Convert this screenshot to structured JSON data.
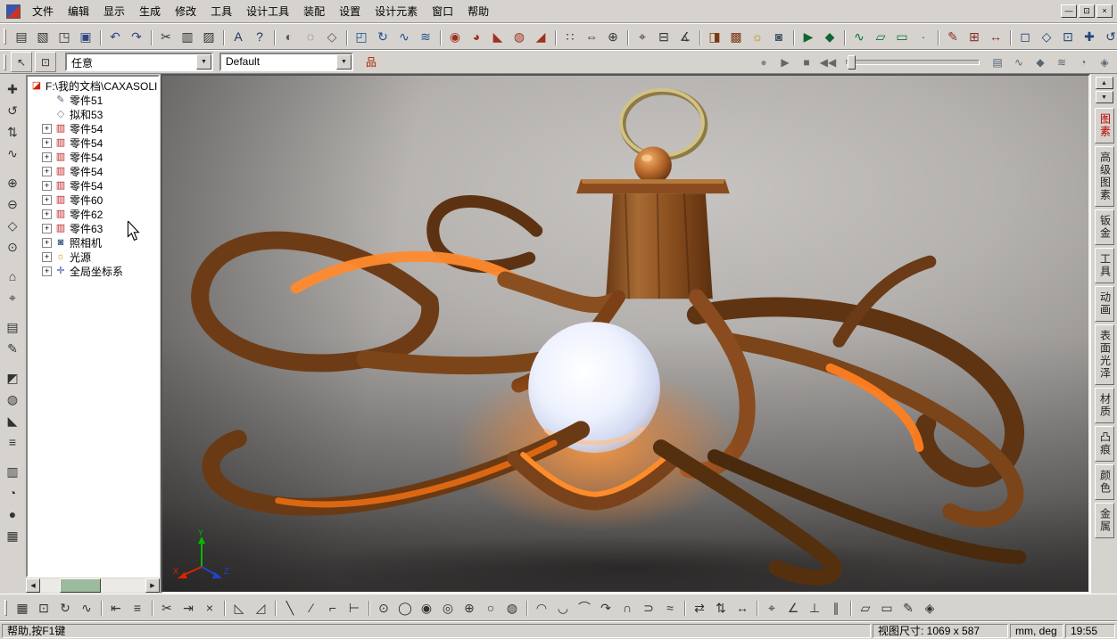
{
  "theme": {
    "chrome": "#d6d3ce",
    "chrome_dark": "#848484",
    "chrome_light": "#ffffff",
    "tree_thumb_green": "#9cba9c"
  },
  "icons": {
    "chevron_down": "▼",
    "scroll_left": "◀",
    "scroll_right": "▶"
  },
  "menu": {
    "items": [
      "文件",
      "编辑",
      "显示",
      "生成",
      "修改",
      "工具",
      "设计工具",
      "装配",
      "设置",
      "设计元素",
      "窗口",
      "帮助"
    ]
  },
  "window_controls": [
    {
      "name": "minimize-button",
      "g": "—"
    },
    {
      "name": "restore-button",
      "g": "⊡"
    },
    {
      "name": "close-button",
      "g": "×"
    }
  ],
  "toolbar_main": {
    "icons": [
      {
        "name": "new-file-icon",
        "g": "▤"
      },
      {
        "name": "new-assembly-icon",
        "g": "▧"
      },
      {
        "name": "open-file-icon",
        "g": "◳"
      },
      {
        "name": "save-icon",
        "g": "▣",
        "c": "#334488"
      },
      {
        "name": "undo-icon",
        "g": "↶",
        "sep": true,
        "c": "#334488"
      },
      {
        "name": "redo-icon",
        "g": "↷",
        "c": "#334488"
      },
      {
        "name": "cut-icon",
        "g": "✂",
        "sep": true
      },
      {
        "name": "copy-icon",
        "g": "▥"
      },
      {
        "name": "paste-icon",
        "g": "▨"
      },
      {
        "name": "find-icon",
        "g": "A",
        "sep": true,
        "c": "#223366"
      },
      {
        "name": "context-help-icon",
        "g": "?",
        "c": "#223366"
      },
      {
        "name": "shaded-view-icon",
        "g": "◐",
        "sep": true,
        "c": "#555555"
      },
      {
        "name": "wireframe-view-icon",
        "g": "◌",
        "c": "#555555"
      },
      {
        "name": "perspective-view-icon",
        "g": "◇",
        "c": "#555555"
      },
      {
        "name": "extrude-icon",
        "g": "◰",
        "sep": true,
        "c": "#1a4f8f"
      },
      {
        "name": "revolve-icon",
        "g": "↻",
        "c": "#1a4f8f"
      },
      {
        "name": "sweep-icon",
        "g": "∿",
        "c": "#1a4f8f"
      },
      {
        "name": "loft-icon",
        "g": "≋",
        "c": "#1a4f8f"
      },
      {
        "name": "hole-icon",
        "g": "◉",
        "sep": true,
        "c": "#a03020"
      },
      {
        "name": "round-icon",
        "g": "◕",
        "c": "#a03020"
      },
      {
        "name": "chamfer-icon",
        "g": "◣",
        "c": "#a03020"
      },
      {
        "name": "shell-icon",
        "g": "◍",
        "c": "#a03020"
      },
      {
        "name": "draft-icon",
        "g": "◢",
        "c": "#a03020"
      },
      {
        "name": "pattern-icon",
        "g": "∷",
        "sep": true,
        "c": "#333333"
      },
      {
        "name": "mirror-icon",
        "g": "⇔",
        "c": "#333333"
      },
      {
        "name": "boolean-icon",
        "g": "⊕",
        "c": "#333333"
      },
      {
        "name": "measure-icon",
        "g": "⌖",
        "sep": true,
        "c": "#333333"
      },
      {
        "name": "section-icon",
        "g": "⊟",
        "c": "#333333"
      },
      {
        "name": "angle-icon",
        "g": "∡",
        "c": "#333333"
      },
      {
        "name": "material-icon",
        "g": "◨",
        "sep": true,
        "c": "#7a3a10"
      },
      {
        "name": "texture-icon",
        "g": "▩",
        "c": "#7a3a10"
      },
      {
        "name": "light-source-icon",
        "g": "☼",
        "c": "#b58900"
      },
      {
        "name": "camera-icon",
        "g": "◙",
        "c": "#445566"
      },
      {
        "name": "animation-play-icon",
        "g": "▶",
        "sep": true,
        "c": "#116633"
      },
      {
        "name": "keyframe-icon",
        "g": "◆",
        "c": "#116633"
      },
      {
        "name": "curve-icon",
        "g": "∿",
        "sep": true,
        "c": "#0a6b3d"
      },
      {
        "name": "surface-icon",
        "g": "▱",
        "c": "#0a6b3d"
      },
      {
        "name": "plane-icon",
        "g": "▭",
        "c": "#0a6b3d"
      },
      {
        "name": "point-icon",
        "g": "·",
        "c": "#0a6b3d"
      },
      {
        "name": "sketch-icon",
        "g": "✎",
        "sep": true,
        "c": "#8a2b2b"
      },
      {
        "name": "grid-icon",
        "g": "⊞",
        "c": "#8a2b2b"
      },
      {
        "name": "dimension-icon",
        "g": "↔",
        "c": "#8a2b2b"
      },
      {
        "name": "front-view-icon",
        "g": "◻",
        "sep": true,
        "c": "#224477"
      },
      {
        "name": "iso-view-icon",
        "g": "◇",
        "c": "#224477"
      },
      {
        "name": "zoom-fit-icon",
        "g": "⊡",
        "c": "#224477"
      },
      {
        "name": "pan-view-icon",
        "g": "✚",
        "c": "#224477"
      },
      {
        "name": "orbit-view-icon",
        "g": "↺",
        "c": "#224477"
      }
    ]
  },
  "toolbar_context": {
    "select_icons": [
      {
        "name": "select-arrow-icon",
        "g": "↖"
      },
      {
        "name": "select-box-icon",
        "g": "⊡"
      }
    ],
    "filter_dropdown_value": "任意",
    "config_dropdown_value": "Default",
    "tree_icons": [
      {
        "name": "assembly-tree-icon",
        "g": "品",
        "c": "#aa2200"
      }
    ],
    "playback_icons": [
      {
        "name": "record-icon",
        "g": "●",
        "c": "#888888"
      },
      {
        "name": "play-icon",
        "g": "▶",
        "c": "#666666"
      },
      {
        "name": "stop-icon",
        "g": "■",
        "c": "#666666"
      },
      {
        "name": "rewind-icon",
        "g": "◀◀",
        "c": "#666666"
      }
    ],
    "anim_icons": [
      {
        "name": "film-icon",
        "g": "▤",
        "c": "#556677"
      },
      {
        "name": "wave-icon",
        "g": "∿",
        "c": "#556677"
      },
      {
        "name": "anim-keyframe-icon",
        "g": "◆",
        "c": "#556677"
      },
      {
        "name": "graph-icon",
        "g": "≋",
        "c": "#556677"
      },
      {
        "name": "clock-icon",
        "g": "◔",
        "c": "#556677"
      },
      {
        "name": "magnet-icon",
        "g": "◈",
        "c": "#556677"
      }
    ]
  },
  "left_toolbar": {
    "icons": [
      {
        "name": "pan-icon",
        "g": "✚"
      },
      {
        "name": "rotate-view-icon",
        "g": "↺"
      },
      {
        "name": "spin-view-icon",
        "g": "⇅"
      },
      {
        "name": "walk-view-icon",
        "g": "∿"
      },
      {
        "name": "zoom-in-icon",
        "g": "⊕",
        "sep": true
      },
      {
        "name": "zoom-out-icon",
        "g": "⊖"
      },
      {
        "name": "zoom-window-icon",
        "g": "◇"
      },
      {
        "name": "zoom-all-icon",
        "g": "⊙"
      },
      {
        "name": "home-view-icon",
        "g": "⌂",
        "sep": true
      },
      {
        "name": "target-icon",
        "g": "⌖"
      },
      {
        "name": "clipboard-icon",
        "g": "▤",
        "sep": true
      },
      {
        "name": "sketch-edit-icon",
        "g": "✎"
      },
      {
        "name": "shade-mode-icon",
        "g": "◩",
        "sep": true
      },
      {
        "name": "material-ball-icon",
        "g": "◍"
      },
      {
        "name": "triangle-ruler-icon",
        "g": "◣"
      },
      {
        "name": "list-icon",
        "g": "≡"
      },
      {
        "name": "panel-icon",
        "g": "▥",
        "sep": true
      },
      {
        "name": "timer-icon",
        "g": "◔"
      },
      {
        "name": "sphere-icon",
        "g": "●"
      },
      {
        "name": "grid-toggle-icon",
        "g": "▦"
      }
    ]
  },
  "feature_tree": {
    "items": [
      {
        "cls": "root",
        "icon": "◪",
        "ic": "#cc2200",
        "label": "F:\\我的文档\\CAXASOLID\\"
      },
      {
        "icon": "✎",
        "ic": "#556677",
        "label": "零件51"
      },
      {
        "icon": "◇",
        "ic": "#778899",
        "label": "拟和53"
      },
      {
        "plus": "+",
        "icon": "▥",
        "ic": "#bb2222",
        "label": "零件54"
      },
      {
        "plus": "+",
        "icon": "▥",
        "ic": "#bb2222",
        "label": "零件54"
      },
      {
        "plus": "+",
        "icon": "▥",
        "ic": "#bb2222",
        "label": "零件54"
      },
      {
        "plus": "+",
        "icon": "▥",
        "ic": "#bb2222",
        "label": "零件54"
      },
      {
        "plus": "+",
        "icon": "▥",
        "ic": "#bb2222",
        "label": "零件54"
      },
      {
        "plus": "+",
        "icon": "▥",
        "ic": "#bb2222",
        "label": "零件60"
      },
      {
        "plus": "+",
        "icon": "▥",
        "ic": "#bb2222",
        "label": "零件62"
      },
      {
        "plus": "+",
        "icon": "▥",
        "ic": "#bb2222",
        "label": "零件63"
      },
      {
        "plus": "+",
        "icon": "◙",
        "ic": "#446688",
        "label": "照相机"
      },
      {
        "plus": "+",
        "icon": "☼",
        "ic": "#cc9900",
        "label": "光源"
      },
      {
        "plus": "+",
        "icon": "✛",
        "ic": "#3355aa",
        "label": "全局坐标系"
      }
    ]
  },
  "right_panel": {
    "scroll_icons": [
      {
        "name": "tab-scroll-up-icon",
        "g": "▲"
      },
      {
        "name": "tab-scroll-down-icon",
        "g": "▼"
      }
    ],
    "tabs": [
      {
        "label": "图素",
        "c": "#bb0000"
      },
      {
        "label": "高级图素",
        "c": "#222222"
      },
      {
        "label": "钣金",
        "c": "#222222"
      },
      {
        "label": "工具",
        "c": "#222222"
      },
      {
        "label": "动画",
        "c": "#222222"
      },
      {
        "label": "表面光泽",
        "c": "#222222"
      },
      {
        "label": "材质",
        "c": "#222222"
      },
      {
        "label": "凸痕",
        "c": "#222222"
      },
      {
        "label": "颜色",
        "c": "#222222"
      },
      {
        "label": "金属",
        "c": "#222222"
      }
    ]
  },
  "bottom_toolbar": {
    "icons": [
      {
        "name": "grid-snap-icon",
        "g": "▦"
      },
      {
        "name": "box-snap-icon",
        "g": "⊡"
      },
      {
        "name": "rotate-snap-icon",
        "g": "↻"
      },
      {
        "name": "spline-snap-icon",
        "g": "∿"
      },
      {
        "name": "align-left-icon",
        "g": "⇤",
        "sep": true
      },
      {
        "name": "layers-icon",
        "g": "≡"
      },
      {
        "name": "trim-icon",
        "g": "✂",
        "sep": true
      },
      {
        "name": "extend-icon",
        "g": "⇥"
      },
      {
        "name": "delete-icon",
        "g": "×"
      },
      {
        "name": "chamfer-2d-icon",
        "g": "◺",
        "sep": true
      },
      {
        "name": "fillet-2d-icon",
        "g": "◿"
      },
      {
        "name": "line-icon",
        "g": "╲",
        "sep": true
      },
      {
        "name": "line-angle-icon",
        "g": "∕"
      },
      {
        "name": "polyline-icon",
        "g": "⌐"
      },
      {
        "name": "perpendicular-line-icon",
        "g": "⊢"
      },
      {
        "name": "circle-center-icon",
        "g": "⊙",
        "sep": true
      },
      {
        "name": "circle-icon",
        "g": "◯"
      },
      {
        "name": "circle-2pt-icon",
        "g": "◉"
      },
      {
        "name": "circle-3pt-icon",
        "g": "◎"
      },
      {
        "name": "circle-tangent-icon",
        "g": "⊕"
      },
      {
        "name": "ellipse-icon",
        "g": "○"
      },
      {
        "name": "donut-icon",
        "g": "◍"
      },
      {
        "name": "arc-icon",
        "g": "◠",
        "sep": true
      },
      {
        "name": "arc-2-icon",
        "g": "◡"
      },
      {
        "name": "arc-3pt-icon",
        "g": "⌒"
      },
      {
        "name": "arc-tangent-icon",
        "g": "↷"
      },
      {
        "name": "arc-cap-icon",
        "g": "∩"
      },
      {
        "name": "curve-open-icon",
        "g": "⊃"
      },
      {
        "name": "wave-curve-icon",
        "g": "≈"
      },
      {
        "name": "mirror-2d-icon",
        "g": "⇄",
        "sep": true
      },
      {
        "name": "offset-icon",
        "g": "⇅"
      },
      {
        "name": "stretch-icon",
        "g": "↔"
      },
      {
        "name": "point-snap-icon",
        "g": "⌖",
        "sep": true
      },
      {
        "name": "angle-dim-icon",
        "g": "∠"
      },
      {
        "name": "perpendicular-icon",
        "g": "⊥"
      },
      {
        "name": "parallel-icon",
        "g": "∥"
      },
      {
        "name": "polygon-icon",
        "g": "▱",
        "sep": true
      },
      {
        "name": "rectangle-icon",
        "g": "▭"
      },
      {
        "name": "pencil-icon",
        "g": "✎"
      },
      {
        "name": "block-icon",
        "g": "◈"
      }
    ]
  },
  "status_bar": {
    "help": "帮助,按F1键",
    "view_size": "视图尺寸: 1069 x 587",
    "units": "mm, deg",
    "time": "19:55"
  },
  "viewport": {
    "axis": {
      "x": "X",
      "y": "Y",
      "z": "Z"
    },
    "colors": {
      "background_light": "#c7c4c1",
      "background_dark": "#4f4d4b",
      "wood": "#7a4519",
      "wood_dark": "#55300f",
      "glow_orange": "#ff8426",
      "bulb": "#eef2fe",
      "ring_brass": "#d3c285"
    }
  }
}
